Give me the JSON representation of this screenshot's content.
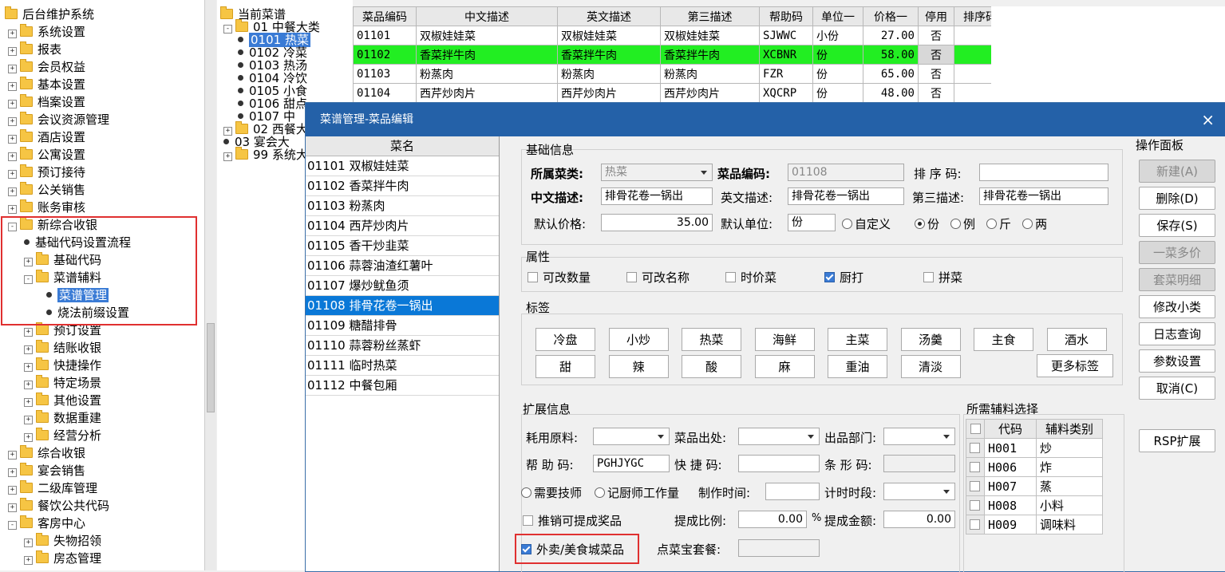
{
  "left_tree": [
    {
      "label": "后台维护系统",
      "level": 0,
      "type": "root"
    },
    {
      "label": "系统设置",
      "level": 1,
      "expander": "+"
    },
    {
      "label": "报表",
      "level": 1,
      "expander": "+"
    },
    {
      "label": "会员权益",
      "level": 1,
      "expander": "+"
    },
    {
      "label": "基本设置",
      "level": 1,
      "expander": "+"
    },
    {
      "label": "档案设置",
      "level": 1,
      "expander": "+"
    },
    {
      "label": "会议资源管理",
      "level": 1,
      "expander": "+"
    },
    {
      "label": "酒店设置",
      "level": 1,
      "expander": "+"
    },
    {
      "label": "公寓设置",
      "level": 1,
      "expander": "+"
    },
    {
      "label": "预订接待",
      "level": 1,
      "expander": "+"
    },
    {
      "label": "公关销售",
      "level": 1,
      "expander": "+"
    },
    {
      "label": "账务审核",
      "level": 1,
      "expander": "+"
    },
    {
      "label": "新综合收银",
      "level": 1,
      "expander": "-"
    },
    {
      "label": "基础代码设置流程",
      "level": 2,
      "type": "leaf"
    },
    {
      "label": "基础代码",
      "level": 2,
      "expander": "+"
    },
    {
      "label": "菜谱辅料",
      "level": 2,
      "expander": "-"
    },
    {
      "label": "菜谱管理",
      "level": 3,
      "type": "leaf",
      "selected": true
    },
    {
      "label": "烧法前缀设置",
      "level": 3,
      "type": "leaf"
    },
    {
      "label": "预订设置",
      "level": 2,
      "expander": "+"
    },
    {
      "label": "结账收银",
      "level": 2,
      "expander": "+"
    },
    {
      "label": "快捷操作",
      "level": 2,
      "expander": "+"
    },
    {
      "label": "特定场景",
      "level": 2,
      "expander": "+"
    },
    {
      "label": "其他设置",
      "level": 2,
      "expander": "+"
    },
    {
      "label": "数据重建",
      "level": 2,
      "expander": "+"
    },
    {
      "label": "经营分析",
      "level": 2,
      "expander": "+"
    },
    {
      "label": "综合收银",
      "level": 1,
      "expander": "+"
    },
    {
      "label": "宴会销售",
      "level": 1,
      "expander": "+"
    },
    {
      "label": "二级库管理",
      "level": 1,
      "expander": "+"
    },
    {
      "label": "餐饮公共代码",
      "level": 1,
      "expander": "+"
    },
    {
      "label": "客房中心",
      "level": 1,
      "expander": "-"
    },
    {
      "label": "失物招领",
      "level": 2,
      "expander": "+"
    },
    {
      "label": "房态管理",
      "level": 2,
      "expander": "+"
    }
  ],
  "mid_tree": [
    {
      "label": "当前菜谱",
      "level": 0,
      "type": "root"
    },
    {
      "label": "01  中餐大类",
      "level": 1,
      "expander": "-"
    },
    {
      "label": "0101 热菜",
      "level": 2,
      "type": "leaf",
      "selected": true
    },
    {
      "label": "0102 冷菜",
      "level": 2,
      "type": "leaf"
    },
    {
      "label": "0103 热汤",
      "level": 2,
      "type": "leaf"
    },
    {
      "label": "0104 冷饮",
      "level": 2,
      "type": "leaf"
    },
    {
      "label": "0105 小食",
      "level": 2,
      "type": "leaf"
    },
    {
      "label": "0106 甜点",
      "level": 2,
      "type": "leaf"
    },
    {
      "label": "0107 中",
      "level": 2,
      "type": "leaf"
    },
    {
      "label": "02  西餐大",
      "level": 1,
      "expander": "+"
    },
    {
      "label": "03  宴会大",
      "level": 1,
      "type": "leaf"
    },
    {
      "label": "99  系统大",
      "level": 1,
      "expander": "+"
    }
  ],
  "grid": {
    "headers": [
      "菜品编码",
      "中文描述",
      "英文描述",
      "第三描述",
      "帮助码",
      "单位一",
      "价格一",
      "停用",
      "排序码"
    ],
    "rows": [
      [
        "01101",
        "双椒娃娃菜",
        "双椒娃娃菜",
        "双椒娃娃菜",
        "SJWWC",
        "小份",
        "27.00",
        "否",
        ""
      ],
      [
        "01102",
        "香菜拌牛肉",
        "香菜拌牛肉",
        "香菜拌牛肉",
        "XCBNR",
        "份",
        "58.00",
        "否",
        ""
      ],
      [
        "01103",
        "粉蒸肉",
        "粉蒸肉",
        "粉蒸肉",
        "FZR",
        "份",
        "65.00",
        "否",
        ""
      ],
      [
        "01104",
        "西芹炒肉片",
        "西芹炒肉片",
        "西芹炒肉片",
        "XQCRP",
        "份",
        "48.00",
        "否",
        ""
      ]
    ],
    "highlight_row": 1,
    "highlight_color": "#22ee22"
  },
  "dialog": {
    "title": "菜谱管理-菜品编辑",
    "close_icon": "×",
    "list_header": "菜名",
    "list_items": [
      "01101 双椒娃娃菜",
      "01102 香菜拌牛肉",
      "01103 粉蒸肉",
      "01104 西芹炒肉片",
      "01105 香干炒韭菜",
      "01106 蒜蓉油渣红薯叶",
      "01107 爆炒鱿鱼须",
      "01108 排骨花卷一锅出",
      "01109 糖醋排骨",
      "01110 蒜蓉粉丝蒸虾",
      "01111 临时热菜",
      "01112 中餐包厢"
    ],
    "active_item": 7,
    "basic": {
      "group_title": "基础信息",
      "category_label": "所属菜类:",
      "category_value": "热菜",
      "code_label": "菜品编码:",
      "code_value": "01108",
      "sort_label": "排 序 码:",
      "sort_value": "",
      "cn_label": "中文描述:",
      "cn_value": "排骨花卷一锅出",
      "en_label": "英文描述:",
      "en_value": "排骨花卷一锅出",
      "third_label": "第三描述:",
      "third_value": "排骨花卷一锅出",
      "price_label": "默认价格:",
      "price_value": "35.00",
      "unit_label": "默认单位:",
      "unit_value": "份",
      "unit_options": [
        "自定义",
        "份",
        "例",
        "斤",
        "两"
      ],
      "unit_selected": "份"
    },
    "attributes": {
      "group_title": "属性",
      "items": [
        {
          "label": "可改数量",
          "checked": false
        },
        {
          "label": "可改名称",
          "checked": false
        },
        {
          "label": "时价菜",
          "checked": false
        },
        {
          "label": "厨打",
          "checked": true
        },
        {
          "label": "拼菜",
          "checked": false
        }
      ]
    },
    "tags": {
      "group_title": "标签",
      "row1": [
        "冷盘",
        "小炒",
        "热菜",
        "海鲜",
        "主菜",
        "汤羹",
        "主食",
        "酒水"
      ],
      "row2": [
        "甜",
        "辣",
        "酸",
        "麻",
        "重油",
        "清淡"
      ],
      "more_label": "更多标签"
    },
    "extended": {
      "group_title": "扩展信息",
      "material_label": "耗用原料:",
      "material_value": "",
      "origin_label": "菜品出处:",
      "origin_value": "",
      "dept_label": "出品部门:",
      "dept_value": "",
      "help_label": "帮 助 码:",
      "help_value": "PGHJYGC",
      "shortcut_label": "快 捷 码:",
      "shortcut_value": "",
      "barcode_label": "条 形 码:",
      "barcode_value": "",
      "skill_label": "需要技师",
      "chef_label": "记厨师工作量",
      "time_label": "制作时间:",
      "time_value": "",
      "period_label": "计时时段:",
      "period_value": "",
      "promo_label": "推销可提成奖品",
      "promo_checked": false,
      "ratio_label": "提成比例:",
      "ratio_value": "0.00",
      "percent": "%",
      "amount_label": "提成金额:",
      "amount_value": "0.00",
      "takeout_label": "外卖/美食城菜品",
      "takeout_checked": true,
      "bao_label": "点菜宝套餐:",
      "bao_value": ""
    },
    "aux": {
      "group_title": "所需辅料选择",
      "headers": [
        "代码",
        "辅料类别"
      ],
      "rows": [
        [
          "H001",
          "炒"
        ],
        [
          "H006",
          "炸"
        ],
        [
          "H007",
          "蒸"
        ],
        [
          "H008",
          "小料"
        ],
        [
          "H009",
          "调味料"
        ]
      ]
    },
    "ops": {
      "group_title": "操作面板",
      "buttons": [
        {
          "label": "新建(A)",
          "disabled": true
        },
        {
          "label": "删除(D)",
          "disabled": false
        },
        {
          "label": "保存(S)",
          "disabled": false
        },
        {
          "label": "一菜多价",
          "disabled": true
        },
        {
          "label": "套菜明细",
          "disabled": true
        },
        {
          "label": "修改小类",
          "disabled": false
        },
        {
          "label": "日志查询",
          "disabled": false
        },
        {
          "label": "参数设置",
          "disabled": false
        },
        {
          "label": "取消(C)",
          "disabled": false
        },
        {
          "label": "RSP扩展",
          "disabled": false
        }
      ]
    }
  },
  "colors": {
    "accent": "#2461a8",
    "selection": "#0a78d7",
    "highlight_box": "#e03030"
  }
}
